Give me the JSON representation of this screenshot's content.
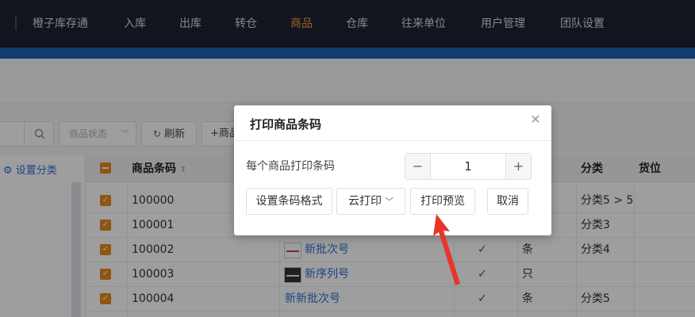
{
  "nav": {
    "items": [
      {
        "label": "橙子库存通",
        "active": false
      },
      {
        "label": "入库",
        "active": false
      },
      {
        "label": "出库",
        "active": false
      },
      {
        "label": "转仓",
        "active": false
      },
      {
        "label": "商品",
        "active": true
      },
      {
        "label": "仓库",
        "active": false
      },
      {
        "label": "往来单位",
        "active": false
      },
      {
        "label": "用户管理",
        "active": false
      },
      {
        "label": "团队设置",
        "active": false
      }
    ]
  },
  "toolbar": {
    "status_placeholder": "商品状态",
    "refresh_label": "刷新",
    "add_label": "+商品"
  },
  "left_panel": {
    "category_setting_label": "设置分类"
  },
  "table": {
    "headers": {
      "barcode": "商品条码",
      "category": "分类",
      "location": "货位"
    },
    "rows": [
      {
        "barcode": "100000",
        "name": "",
        "check": "",
        "unit": "",
        "category": "分类5 > 5"
      },
      {
        "barcode": "100001",
        "name": "",
        "check": "",
        "unit": "",
        "category": "分类3"
      },
      {
        "barcode": "100002",
        "name": "新批次号",
        "check": "✓",
        "unit": "条",
        "category": "分类4"
      },
      {
        "barcode": "100003",
        "name": "新序列号",
        "check": "✓",
        "unit": "只",
        "category": ""
      },
      {
        "barcode": "100004",
        "name": "新新批次号",
        "check": "✓",
        "unit": "条",
        "category": "分类5"
      }
    ]
  },
  "dialog": {
    "title": "打印商品条码",
    "label": "每个商品打印条码",
    "quantity": "1",
    "buttons": {
      "format": "设置条码格式",
      "cloud_print": "云打印",
      "preview": "打印预览",
      "cancel": "取消"
    }
  },
  "colors": {
    "nav_bg": "#1d2230",
    "accent_active": "#f5a14a",
    "brand_blue": "#1e5fb4",
    "checkbox": "#e58a1f",
    "link": "#2b6fd4",
    "arrow": "#e8352b"
  }
}
